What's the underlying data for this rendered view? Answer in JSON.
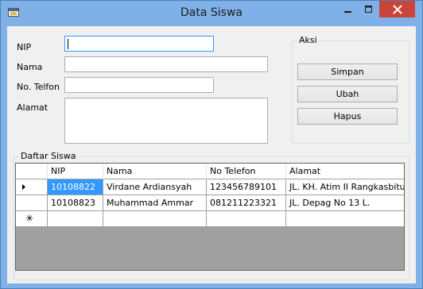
{
  "window": {
    "title": "Data Siswa"
  },
  "form": {
    "nip_label": "NIP",
    "nip_value": "",
    "nama_label": "Nama",
    "nama_value": "",
    "telfon_label": "No. Telfon",
    "telfon_value": "",
    "alamat_label": "Alamat",
    "alamat_value": ""
  },
  "aksi": {
    "title": "Aksi",
    "simpan": "Simpan",
    "ubah": "Ubah",
    "hapus": "Hapus"
  },
  "daftar": {
    "title": "Daftar Siswa",
    "columns": [
      "NIP",
      "Nama",
      "No Telefon",
      "Alamat"
    ],
    "rows": [
      {
        "nip": "10108822",
        "nama": "Virdane Ardiansyah",
        "telefon": "123456789101",
        "alamat": "JL. KH. Atim II Rangkasbitung",
        "current": true
      },
      {
        "nip": "10108823",
        "nama": "Muhammad Ammar",
        "telefon": "081211223321",
        "alamat": "JL. Depag No 13 L.",
        "current": false
      }
    ],
    "new_row_marker": "✳"
  },
  "colors": {
    "titlebar": "#7fb1e8",
    "close": "#c9453a",
    "selection": "#3399ff"
  }
}
